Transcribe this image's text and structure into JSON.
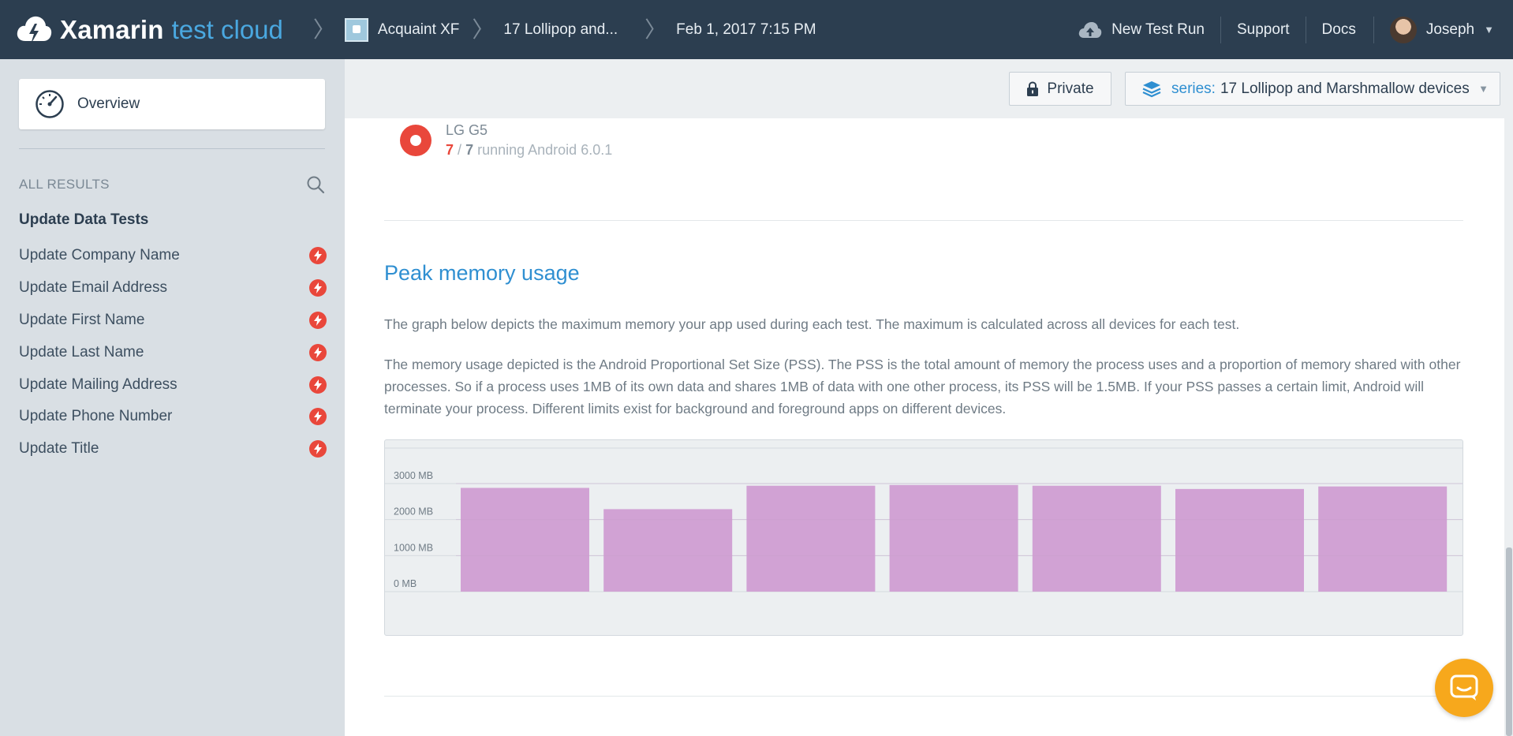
{
  "topbar": {
    "brand_primary": "Xamarin",
    "brand_secondary": "test cloud",
    "breadcrumbs": [
      "Acquaint XF",
      "17 Lollipop and...",
      "Feb 1, 2017 7:15 PM"
    ],
    "new_test_run": "New Test Run",
    "support": "Support",
    "docs": "Docs",
    "user": "Joseph"
  },
  "sidebar": {
    "overview": "Overview",
    "all_results": "ALL RESULTS",
    "group_title": "Update Data Tests",
    "items": [
      {
        "label": "Update Company Name",
        "status": "failed"
      },
      {
        "label": "Update Email Address",
        "status": "failed"
      },
      {
        "label": "Update First Name",
        "status": "failed"
      },
      {
        "label": "Update Last Name",
        "status": "failed"
      },
      {
        "label": "Update Mailing Address",
        "status": "failed"
      },
      {
        "label": "Update Phone Number",
        "status": "failed"
      },
      {
        "label": "Update Title",
        "status": "failed"
      }
    ]
  },
  "toolbar": {
    "private_label": "Private",
    "series_prefix": "series:",
    "series_value": "17 Lollipop and Marshmallow devices"
  },
  "device": {
    "name": "LG G5",
    "failed": "7",
    "separator": "/",
    "total": "7",
    "running": "running Android 6.0.1"
  },
  "section": {
    "title": "Peak memory usage",
    "para1": "The graph below depicts the maximum memory your app used during each test. The maximum is calculated across all devices for each test.",
    "para2": "The memory usage depicted is the Android Proportional Set Size (PSS). The PSS is the total amount of memory the process uses and a proportion of memory shared with other processes. So if a process uses 1MB of its own data and shares 1MB of data with one other process, its PSS will be 1.5MB. If your PSS passes a certain limit, Android will terminate your process. Different limits exist for background and foreground apps on different devices."
  },
  "colors": {
    "topbar_bg": "#2c3e50",
    "accent": "#2f8fd1",
    "fail": "#e9473b",
    "bar": "#d1a2d4",
    "chat": "#f7a81c"
  },
  "chart_data": {
    "type": "bar",
    "categories": [],
    "values": [
      2880,
      2290,
      2940,
      2960,
      2940,
      2850,
      2920
    ],
    "y_ticks": [
      "0 MB",
      "1000 MB",
      "2000 MB",
      "3000 MB"
    ],
    "y_tick_values": [
      0,
      1000,
      2000,
      3000
    ],
    "ylim": [
      0,
      3000
    ],
    "grid": true,
    "bar_color": "#d1a2d4"
  }
}
